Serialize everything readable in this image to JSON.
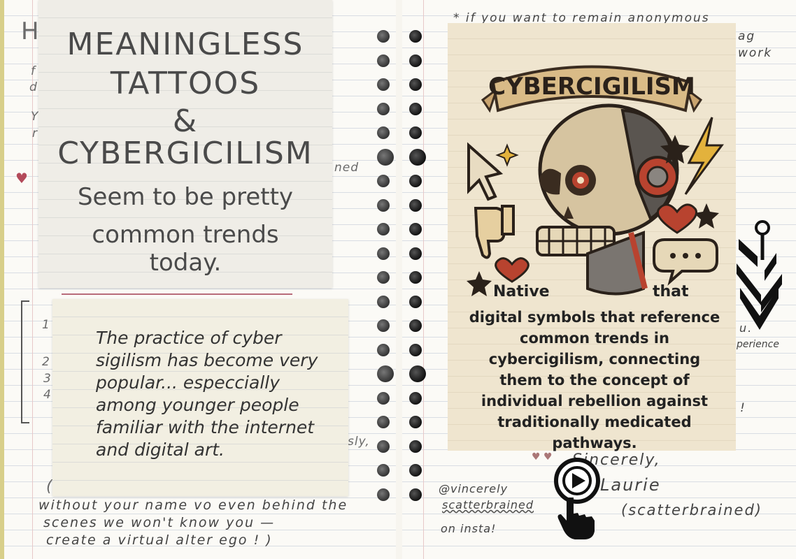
{
  "title_card": {
    "line1": "MEANINGLESS",
    "line2": "TATTOOS",
    "line3": "&",
    "line4": "CYBERGICILISM",
    "line5": "Seem to be pretty",
    "line6": "common trends",
    "line7": "today."
  },
  "note_card": {
    "text": "The practice of cyber sigilism has become very popular... especcially among younger people familiar with the internet and digital art."
  },
  "poster": {
    "banner": "CYBERCIGILISM",
    "caption_lead": "Native",
    "caption_lead2": "that",
    "caption": "digital symbols that reference common trends in cybercigilism, connecting them to the concept of individual rebellion against traditionally medicated pathways."
  },
  "background_notes": {
    "left_heading": "H",
    "left_f": "f",
    "left_d": "d",
    "left_y": "Y",
    "left_r": "r",
    "left_ned": "ned",
    "left_sly": "sly,",
    "left_paren": "(",
    "left_bottom1": "without your name vo even behind the",
    "left_bottom2": "scenes we won't know you —",
    "left_bottom3": "create a virtual alter ego ! )",
    "list_1": "1",
    "list_2": "2",
    "list_3": "3",
    "list_4": "4",
    "right_top1": "* if you want to remain anonymous",
    "right_top2": "ag",
    "right_top3": "work",
    "right_u": "u.",
    "right_experience": "perience",
    "right_excl": "!",
    "handle1": "@vincerely",
    "handle2": "scatterbrained",
    "handle3": "on insta!",
    "signoff1": "Sincerely,",
    "signoff2": "Laurie",
    "signoff3": "(scatterbrained)"
  },
  "icons": {
    "play": "play-cursor-icon",
    "sigil": "cyber-sigil-icon",
    "skull": "robot-skull-icon"
  },
  "colors": {
    "poster_bg": "#efe5cf",
    "accent_red": "#b8432f",
    "accent_yellow": "#e3b23c",
    "ink": "#333333"
  }
}
